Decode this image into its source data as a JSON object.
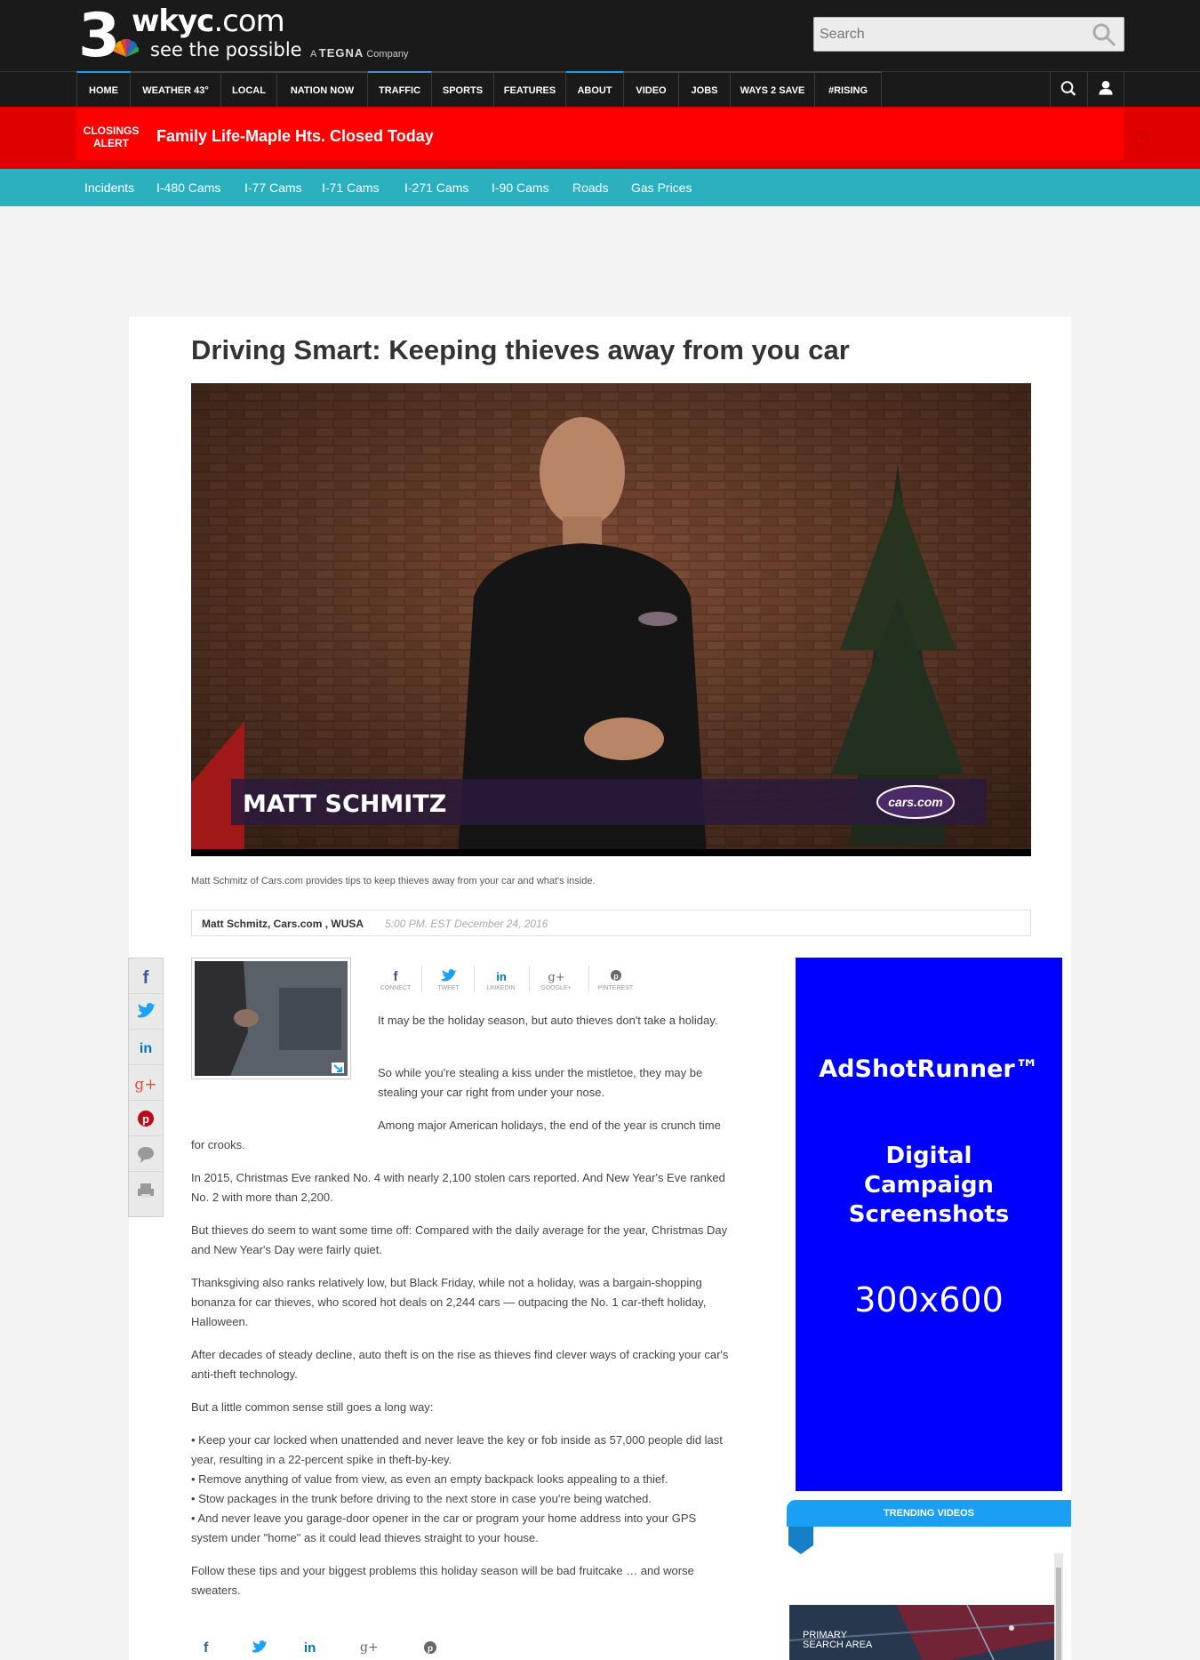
{
  "header": {
    "logo_number": "3",
    "logo_site": "wkyc",
    "logo_site_suffix": ".com",
    "logo_tagline": "see the possible",
    "logo_company_prefix": "A",
    "logo_company": "TEGNA",
    "logo_company_suffix": "Company",
    "search_placeholder": "Search"
  },
  "nav": {
    "items": [
      "HOME",
      "WEATHER 43°",
      "LOCAL",
      "NATION NOW",
      "TRAFFIC",
      "SPORTS",
      "FEATURES",
      "ABOUT",
      "VIDEO",
      "JOBS",
      "WAYS 2 SAVE",
      "#RISING"
    ]
  },
  "alert": {
    "label_line1": "CLOSINGS",
    "label_line2": "ALERT",
    "text": "Family Life-Maple Hts. Closed Today"
  },
  "traffic": {
    "links": [
      "Incidents",
      "I-480 Cams",
      "I-77 Cams",
      "I-71 Cams",
      "I-271 Cams",
      "I-90 Cams",
      "Roads",
      "Gas Prices"
    ]
  },
  "article": {
    "headline": "Driving Smart: Keeping thieves away from you car",
    "video_lower_third": "MATT SCHMITZ",
    "video_logo": "cars.com",
    "caption": "Matt Schmitz of Cars.com provides tips to keep thieves away from your car and what's inside.",
    "author": "Matt Schmitz, Cars.com , WUSA",
    "date": "5:00 PM. EST December 24, 2016",
    "share_labels": [
      "CONNECT",
      "TWEET",
      "LINKEDIN",
      "GOOGLE+",
      "PINTEREST"
    ],
    "paragraphs": [
      "It may be the holiday season, but auto thieves don't take a holiday.",
      "So while you're stealing a kiss under the mistletoe, they may be stealing your car right from under your nose.",
      "Among major American holidays, the end of the year is crunch time for crooks.",
      "In 2015, Christmas Eve ranked No. 4 with nearly 2,100 stolen cars reported. And New Year's Eve ranked No. 2 with more than 2,200.",
      "But thieves do seem to want some time off: Compared with the daily average for the year, Christmas Day and New Year's Day were fairly quiet.",
      "Thanksgiving also ranks relatively low, but Black Friday, while not a holiday, was a bargain-shopping bonanza for car thieves, who scored hot deals on 2,244 cars — outpacing the No. 1 car-theft holiday, Halloween.",
      "After decades of steady decline, auto theft is on the rise as thieves find clever ways of cracking your car's anti-theft technology.",
      "But a little common sense still goes a long way:",
      "• Keep your car locked when unattended and never leave the key or fob inside as 57,000 people did last year, resulting in a 22-percent spike in theft-by-key.",
      "• Remove anything of value from view, as even an empty backpack looks appealing to a thief.",
      "• Stow packages in the trunk before driving to the next store in case you're being watched.",
      "• And never leave you garage-door opener in the car or program your home address into your GPS system under \"home\" as it could lead thieves straight to your house.",
      "Follow these tips and your biggest problems this holiday season will be bad fruitcake … and worse sweaters."
    ]
  },
  "ad": {
    "brand": "AdShotRunner™",
    "line1": "Digital",
    "line2": "Campaign",
    "line3": "Screenshots",
    "size": "300x600",
    "color": "#0000ff"
  },
  "trending": {
    "title": "TRENDING VIDEOS",
    "thumb_label_line1": "PRIMARY",
    "thumb_label_line2": "SEARCH AREA"
  },
  "colors": {
    "alert_red": "#ff0000",
    "traffic_teal": "#2ab0bf",
    "trending_blue": "#1a9ff5",
    "facebook": "#3b5998",
    "twitter": "#1da1f2",
    "linkedin": "#0077b5",
    "google": "#dd4b39",
    "pinterest": "#bd081c"
  }
}
